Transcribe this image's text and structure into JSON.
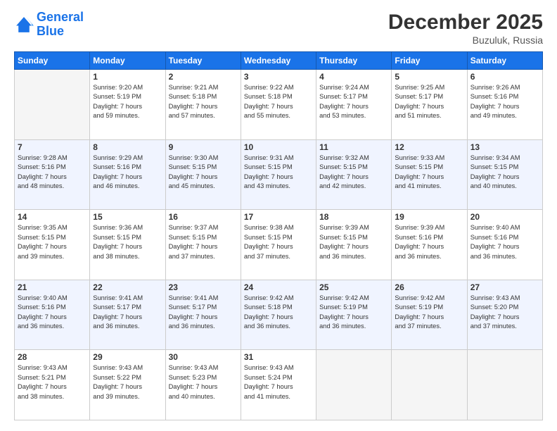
{
  "header": {
    "logo_line1": "General",
    "logo_line2": "Blue",
    "month_title": "December 2025",
    "location": "Buzuluk, Russia"
  },
  "weekdays": [
    "Sunday",
    "Monday",
    "Tuesday",
    "Wednesday",
    "Thursday",
    "Friday",
    "Saturday"
  ],
  "weeks": [
    {
      "days": [
        {
          "num": "",
          "info": ""
        },
        {
          "num": "1",
          "info": "Sunrise: 9:20 AM\nSunset: 5:19 PM\nDaylight: 7 hours\nand 59 minutes."
        },
        {
          "num": "2",
          "info": "Sunrise: 9:21 AM\nSunset: 5:18 PM\nDaylight: 7 hours\nand 57 minutes."
        },
        {
          "num": "3",
          "info": "Sunrise: 9:22 AM\nSunset: 5:18 PM\nDaylight: 7 hours\nand 55 minutes."
        },
        {
          "num": "4",
          "info": "Sunrise: 9:24 AM\nSunset: 5:17 PM\nDaylight: 7 hours\nand 53 minutes."
        },
        {
          "num": "5",
          "info": "Sunrise: 9:25 AM\nSunset: 5:17 PM\nDaylight: 7 hours\nand 51 minutes."
        },
        {
          "num": "6",
          "info": "Sunrise: 9:26 AM\nSunset: 5:16 PM\nDaylight: 7 hours\nand 49 minutes."
        }
      ]
    },
    {
      "days": [
        {
          "num": "7",
          "info": "Sunrise: 9:28 AM\nSunset: 5:16 PM\nDaylight: 7 hours\nand 48 minutes."
        },
        {
          "num": "8",
          "info": "Sunrise: 9:29 AM\nSunset: 5:16 PM\nDaylight: 7 hours\nand 46 minutes."
        },
        {
          "num": "9",
          "info": "Sunrise: 9:30 AM\nSunset: 5:15 PM\nDaylight: 7 hours\nand 45 minutes."
        },
        {
          "num": "10",
          "info": "Sunrise: 9:31 AM\nSunset: 5:15 PM\nDaylight: 7 hours\nand 43 minutes."
        },
        {
          "num": "11",
          "info": "Sunrise: 9:32 AM\nSunset: 5:15 PM\nDaylight: 7 hours\nand 42 minutes."
        },
        {
          "num": "12",
          "info": "Sunrise: 9:33 AM\nSunset: 5:15 PM\nDaylight: 7 hours\nand 41 minutes."
        },
        {
          "num": "13",
          "info": "Sunrise: 9:34 AM\nSunset: 5:15 PM\nDaylight: 7 hours\nand 40 minutes."
        }
      ]
    },
    {
      "days": [
        {
          "num": "14",
          "info": "Sunrise: 9:35 AM\nSunset: 5:15 PM\nDaylight: 7 hours\nand 39 minutes."
        },
        {
          "num": "15",
          "info": "Sunrise: 9:36 AM\nSunset: 5:15 PM\nDaylight: 7 hours\nand 38 minutes."
        },
        {
          "num": "16",
          "info": "Sunrise: 9:37 AM\nSunset: 5:15 PM\nDaylight: 7 hours\nand 37 minutes."
        },
        {
          "num": "17",
          "info": "Sunrise: 9:38 AM\nSunset: 5:15 PM\nDaylight: 7 hours\nand 37 minutes."
        },
        {
          "num": "18",
          "info": "Sunrise: 9:39 AM\nSunset: 5:15 PM\nDaylight: 7 hours\nand 36 minutes."
        },
        {
          "num": "19",
          "info": "Sunrise: 9:39 AM\nSunset: 5:16 PM\nDaylight: 7 hours\nand 36 minutes."
        },
        {
          "num": "20",
          "info": "Sunrise: 9:40 AM\nSunset: 5:16 PM\nDaylight: 7 hours\nand 36 minutes."
        }
      ]
    },
    {
      "days": [
        {
          "num": "21",
          "info": "Sunrise: 9:40 AM\nSunset: 5:16 PM\nDaylight: 7 hours\nand 36 minutes."
        },
        {
          "num": "22",
          "info": "Sunrise: 9:41 AM\nSunset: 5:17 PM\nDaylight: 7 hours\nand 36 minutes."
        },
        {
          "num": "23",
          "info": "Sunrise: 9:41 AM\nSunset: 5:17 PM\nDaylight: 7 hours\nand 36 minutes."
        },
        {
          "num": "24",
          "info": "Sunrise: 9:42 AM\nSunset: 5:18 PM\nDaylight: 7 hours\nand 36 minutes."
        },
        {
          "num": "25",
          "info": "Sunrise: 9:42 AM\nSunset: 5:19 PM\nDaylight: 7 hours\nand 36 minutes."
        },
        {
          "num": "26",
          "info": "Sunrise: 9:42 AM\nSunset: 5:19 PM\nDaylight: 7 hours\nand 37 minutes."
        },
        {
          "num": "27",
          "info": "Sunrise: 9:43 AM\nSunset: 5:20 PM\nDaylight: 7 hours\nand 37 minutes."
        }
      ]
    },
    {
      "days": [
        {
          "num": "28",
          "info": "Sunrise: 9:43 AM\nSunset: 5:21 PM\nDaylight: 7 hours\nand 38 minutes."
        },
        {
          "num": "29",
          "info": "Sunrise: 9:43 AM\nSunset: 5:22 PM\nDaylight: 7 hours\nand 39 minutes."
        },
        {
          "num": "30",
          "info": "Sunrise: 9:43 AM\nSunset: 5:23 PM\nDaylight: 7 hours\nand 40 minutes."
        },
        {
          "num": "31",
          "info": "Sunrise: 9:43 AM\nSunset: 5:24 PM\nDaylight: 7 hours\nand 41 minutes."
        },
        {
          "num": "",
          "info": ""
        },
        {
          "num": "",
          "info": ""
        },
        {
          "num": "",
          "info": ""
        }
      ]
    }
  ]
}
